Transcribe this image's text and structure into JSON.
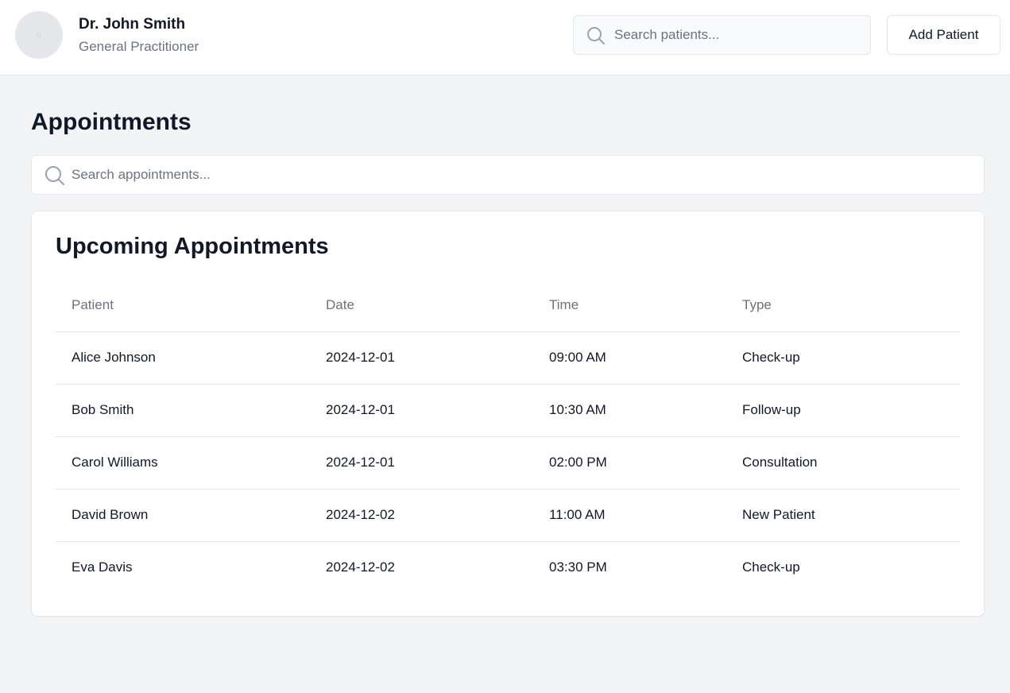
{
  "header": {
    "doctor_name": "Dr. John Smith",
    "doctor_role": "General Practitioner",
    "search_placeholder": "Search patients...",
    "add_patient_label": "Add Patient"
  },
  "main": {
    "title": "Appointments",
    "search_placeholder": "Search appointments..."
  },
  "appointments": {
    "title": "Upcoming Appointments",
    "columns": [
      "Patient",
      "Date",
      "Time",
      "Type"
    ],
    "rows": [
      [
        "Alice Johnson",
        "2024-12-01",
        "09:00 AM",
        "Check-up"
      ],
      [
        "Bob Smith",
        "2024-12-01",
        "10:30 AM",
        "Follow-up"
      ],
      [
        "Carol Williams",
        "2024-12-01",
        "02:00 PM",
        "Consultation"
      ],
      [
        "David Brown",
        "2024-12-02",
        "11:00 AM",
        "New Patient"
      ],
      [
        "Eva Davis",
        "2024-12-02",
        "03:30 PM",
        "Check-up"
      ]
    ]
  },
  "icons": {
    "patient_search": "search-icon",
    "appointment_search": "search-icon",
    "avatar": "avatar-placeholder"
  },
  "colors": {
    "page_background": "#f3f4f6",
    "surface": "#ffffff",
    "border": "#e5e7eb",
    "text_primary": "#111827",
    "text_secondary": "#6b7280"
  }
}
